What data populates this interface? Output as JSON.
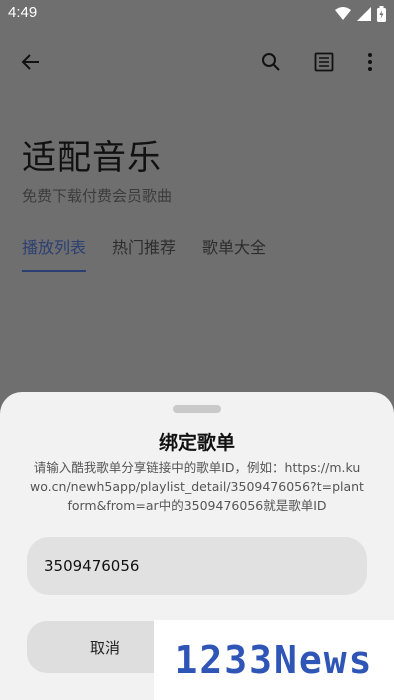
{
  "status_bar": {
    "time": "4:49",
    "icons": [
      "wifi-icon",
      "signal-icon",
      "battery-icon"
    ]
  },
  "toolbar": {
    "icons": [
      "back-arrow-icon",
      "search-icon",
      "list-icon",
      "more-vert-icon"
    ]
  },
  "hero": {
    "title": "适配音乐",
    "subtitle": "免费下载付费会员歌曲"
  },
  "tabs": [
    {
      "label": "播放列表",
      "active": true
    },
    {
      "label": "热门推荐",
      "active": false
    },
    {
      "label": "歌单大全",
      "active": false
    }
  ],
  "sheet": {
    "title": "绑定歌单",
    "description": "请输入酷我歌单分享链接中的歌单ID，例如：https://m.kuwo.cn/newh5app/playlist_detail/3509476056?t=plantform&from=ar中的3509476056就是歌单ID",
    "input_value": "3509476056",
    "cancel_label": "取消"
  },
  "watermark": {
    "text": "1233News"
  },
  "colors": {
    "accent": "#2b3f72",
    "overlay": "#6f6f6f",
    "sheet_bg": "#f2f2f2",
    "watermark": "#2f55b7"
  }
}
